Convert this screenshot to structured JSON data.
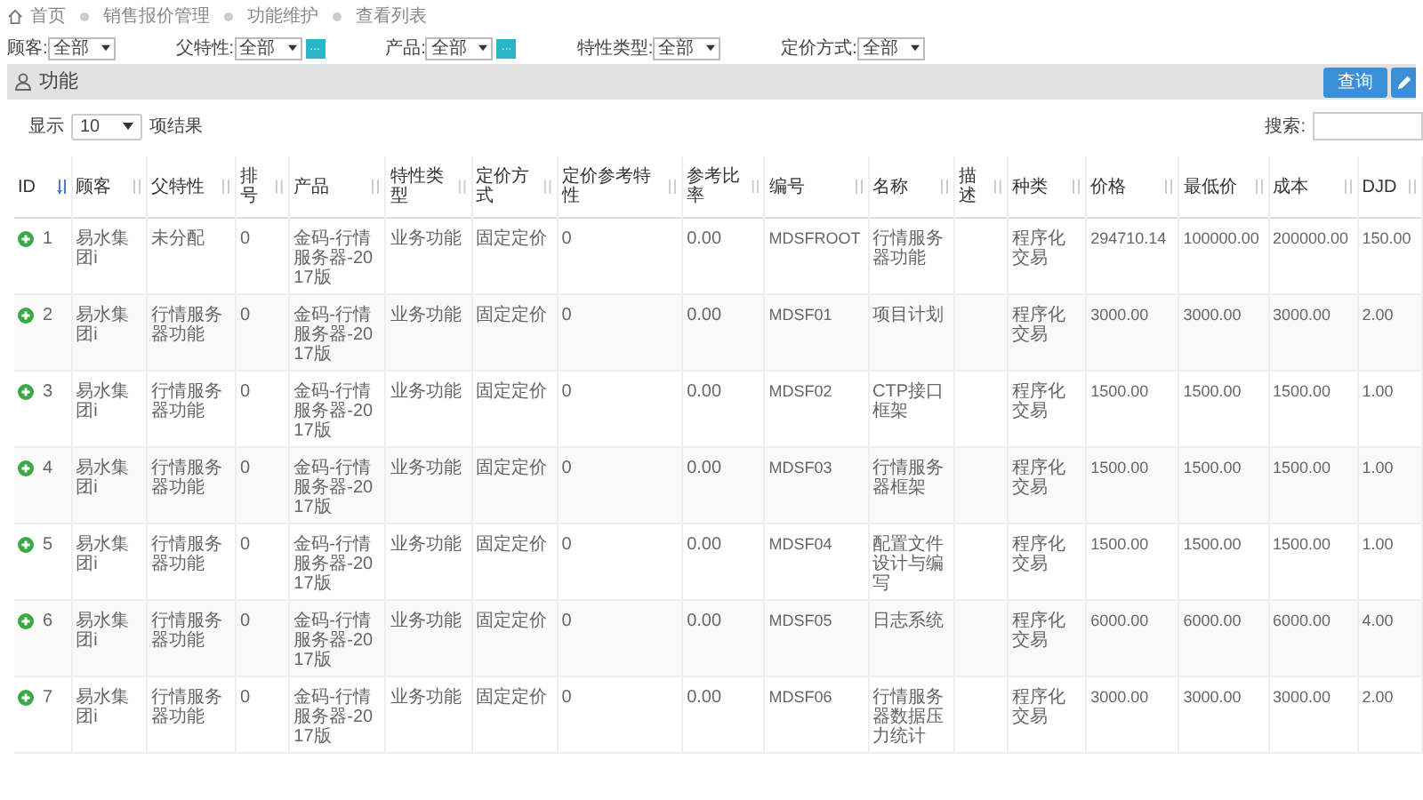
{
  "breadcrumb": [
    "首页",
    "销售报价管理",
    "功能维护",
    "查看列表"
  ],
  "filters": [
    {
      "label": "顾客:",
      "value": "全部"
    },
    {
      "label": "父特性:",
      "value": "全部",
      "picker_label": "..."
    },
    {
      "label": "产品:",
      "value": "全部",
      "picker_label": "..."
    },
    {
      "label": "特性类型:",
      "value": "全部"
    },
    {
      "label": "定价方式:",
      "value": "全部"
    }
  ],
  "panel": {
    "title": "功能",
    "query_button": "查询"
  },
  "page_size": {
    "prefix": "显示",
    "value": "10",
    "suffix": "项结果"
  },
  "search": {
    "label": "搜索:"
  },
  "table": {
    "columns": [
      {
        "label": "ID",
        "sorted": true
      },
      {
        "label": "顾客",
        "sorted": false
      },
      {
        "label": "父特性",
        "sorted": false
      },
      {
        "label": "排号",
        "sorted": false
      },
      {
        "label": "产品",
        "sorted": false
      },
      {
        "label": "特性类型",
        "sorted": false
      },
      {
        "label": "定价方式",
        "sorted": false
      },
      {
        "label": "定价参考特性",
        "sorted": false
      },
      {
        "label": "参考比率",
        "sorted": false
      },
      {
        "label": "编号",
        "sorted": false
      },
      {
        "label": "名称",
        "sorted": false
      },
      {
        "label": "描述",
        "sorted": false
      },
      {
        "label": "种类",
        "sorted": false
      },
      {
        "label": "价格",
        "sorted": false
      },
      {
        "label": "最低价",
        "sorted": false
      },
      {
        "label": "成本",
        "sorted": false
      },
      {
        "label": "DJD",
        "sorted": false
      }
    ],
    "rows": [
      {
        "id": "1",
        "customer": "易水集团i",
        "parent_feature": "未分配",
        "sort_no": "0",
        "product": "金码-行情服务器-2017版",
        "feature_type": "业务功能",
        "pricing_method": "固定定价",
        "pricing_ref": "0",
        "ref_ratio": "0.00",
        "code": "MDSFROOT",
        "name": "行情服务器功能",
        "category": "程序化交易",
        "price": "294710.14",
        "min_price": "100000.00",
        "cost": "200000.00",
        "djd": "150.00"
      },
      {
        "id": "2",
        "customer": "易水集团i",
        "parent_feature": "行情服务器功能",
        "sort_no": "0",
        "product": "金码-行情服务器-2017版",
        "feature_type": "业务功能",
        "pricing_method": "固定定价",
        "pricing_ref": "0",
        "ref_ratio": "0.00",
        "code": "MDSF01",
        "name": "项目计划",
        "category": "程序化交易",
        "price": "3000.00",
        "min_price": "3000.00",
        "cost": "3000.00",
        "djd": "2.00"
      },
      {
        "id": "3",
        "customer": "易水集团i",
        "parent_feature": "行情服务器功能",
        "sort_no": "0",
        "product": "金码-行情服务器-2017版",
        "feature_type": "业务功能",
        "pricing_method": "固定定价",
        "pricing_ref": "0",
        "ref_ratio": "0.00",
        "code": "MDSF02",
        "name": "CTP接口框架",
        "category": "程序化交易",
        "price": "1500.00",
        "min_price": "1500.00",
        "cost": "1500.00",
        "djd": "1.00"
      },
      {
        "id": "4",
        "customer": "易水集团i",
        "parent_feature": "行情服务器功能",
        "sort_no": "0",
        "product": "金码-行情服务器-2017版",
        "feature_type": "业务功能",
        "pricing_method": "固定定价",
        "pricing_ref": "0",
        "ref_ratio": "0.00",
        "code": "MDSF03",
        "name": "行情服务器框架",
        "category": "程序化交易",
        "price": "1500.00",
        "min_price": "1500.00",
        "cost": "1500.00",
        "djd": "1.00"
      },
      {
        "id": "5",
        "customer": "易水集团i",
        "parent_feature": "行情服务器功能",
        "sort_no": "0",
        "product": "金码-行情服务器-2017版",
        "feature_type": "业务功能",
        "pricing_method": "固定定价",
        "pricing_ref": "0",
        "ref_ratio": "0.00",
        "code": "MDSF04",
        "name": "配置文件设计与编写",
        "category": "程序化交易",
        "price": "1500.00",
        "min_price": "1500.00",
        "cost": "1500.00",
        "djd": "1.00"
      },
      {
        "id": "6",
        "customer": "易水集团i",
        "parent_feature": "行情服务器功能",
        "sort_no": "0",
        "product": "金码-行情服务器-2017版",
        "feature_type": "业务功能",
        "pricing_method": "固定定价",
        "pricing_ref": "0",
        "ref_ratio": "0.00",
        "code": "MDSF05",
        "name": "日志系统",
        "category": "程序化交易",
        "price": "6000.00",
        "min_price": "6000.00",
        "cost": "6000.00",
        "djd": "4.00"
      },
      {
        "id": "7",
        "customer": "易水集团i",
        "parent_feature": "行情服务器功能",
        "sort_no": "0",
        "product": "金码-行情服务器-2017版",
        "feature_type": "业务功能",
        "pricing_method": "固定定价",
        "pricing_ref": "0",
        "ref_ratio": "0.00",
        "code": "MDSF06",
        "name": "行情服务器数据压力统计",
        "category": "程序化交易",
        "price": "3000.00",
        "min_price": "3000.00",
        "cost": "3000.00",
        "djd": "2.00"
      }
    ]
  }
}
